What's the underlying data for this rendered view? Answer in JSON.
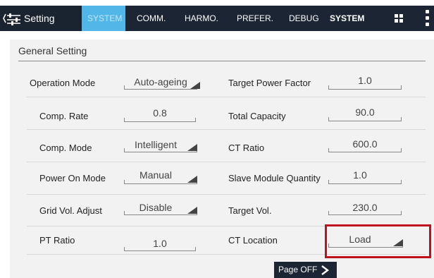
{
  "topbar": {
    "title": "Setting",
    "tabs": [
      "SYSTEM",
      "COMM.",
      "HARMO.",
      "PREFER.",
      "DEBUG",
      "SYSTEM"
    ],
    "active_tab_index": 0
  },
  "section": {
    "title": "General Setting"
  },
  "left_fields": [
    {
      "label": "Operation Mode",
      "value": "Auto-ageing",
      "dropdown": true
    },
    {
      "label": "Comp. Rate",
      "value": "0.8",
      "dropdown": false
    },
    {
      "label": "Comp. Mode",
      "value": "Intelligent",
      "dropdown": true
    },
    {
      "label": "Power On Mode",
      "value": "Manual",
      "dropdown": true
    },
    {
      "label": "Grid Vol. Adjust",
      "value": "Disable",
      "dropdown": true
    },
    {
      "label": "PT Ratio",
      "value": "1.0",
      "dropdown": false
    }
  ],
  "right_fields": [
    {
      "label": "Target Power Factor",
      "value": "1.0",
      "dropdown": false
    },
    {
      "label": "Total Capacity",
      "value": "90.0",
      "dropdown": false
    },
    {
      "label": "CT Ratio",
      "value": "600.0",
      "dropdown": false
    },
    {
      "label": "Slave Module Quantity",
      "value": "1.0",
      "dropdown": false
    },
    {
      "label": "Target Vol.",
      "value": "230.0",
      "dropdown": false
    },
    {
      "label": "CT Location",
      "value": "Load",
      "dropdown": true
    }
  ],
  "footer": {
    "page_off_label": "Page OFF"
  },
  "colors": {
    "topbar": "#1b2533",
    "active_tab": "#52b7e8",
    "highlight": "#c0111f"
  }
}
